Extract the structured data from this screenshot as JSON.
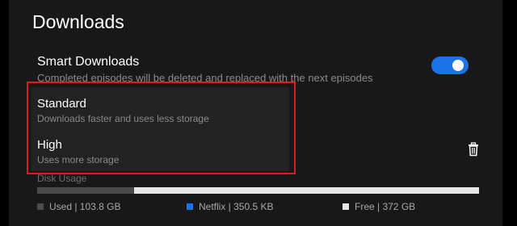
{
  "page": {
    "title": "Downloads"
  },
  "smart_downloads": {
    "label": "Smart Downloads",
    "description": "Completed episodes will be deleted and replaced with the next episodes",
    "enabled": true
  },
  "quality_options": [
    {
      "label": "Standard",
      "description": "Downloads faster and uses less storage"
    },
    {
      "label": "High",
      "description": "Uses more storage"
    }
  ],
  "icons": {
    "delete": "trash-icon"
  },
  "disk_usage": {
    "label": "Disk Usage",
    "used_fraction": 0.22,
    "legend": [
      {
        "label": "Used | 103.8 GB",
        "color": "#4a4a4a"
      },
      {
        "label": "Netflix | 350.5 KB",
        "color": "#1a73e8"
      },
      {
        "label": "Free | 372 GB",
        "color": "#e6e6e6"
      }
    ]
  },
  "colors": {
    "accent": "#1a73e8",
    "highlight": "#e21a1a"
  }
}
